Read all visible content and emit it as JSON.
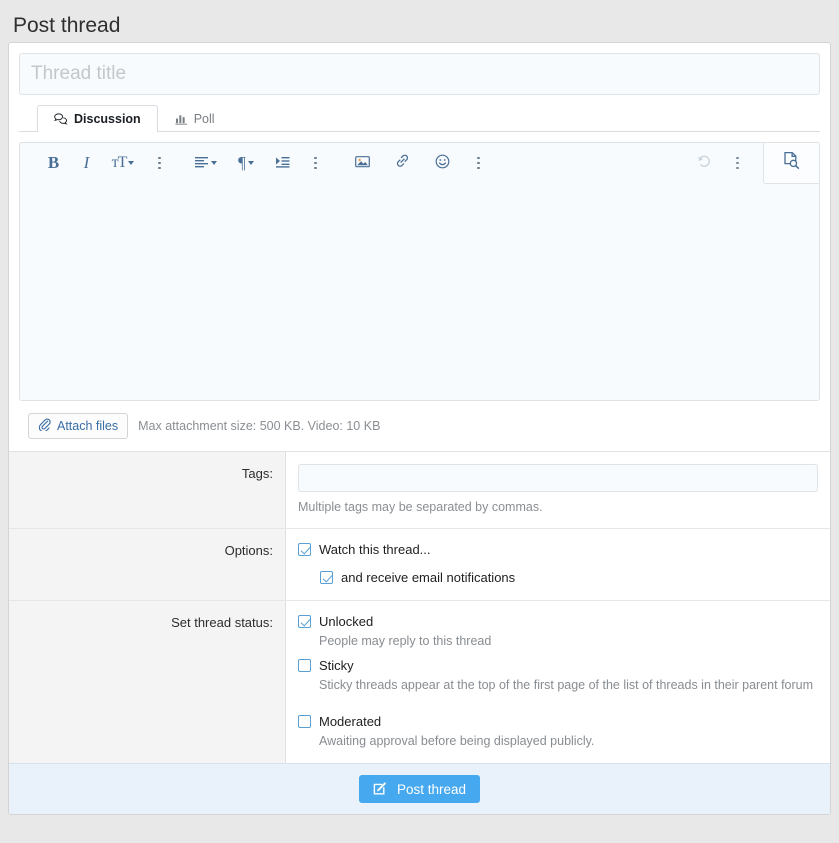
{
  "page": {
    "title": "Post thread"
  },
  "title_field": {
    "placeholder": "Thread title",
    "value": ""
  },
  "tabs": [
    {
      "label": "Discussion",
      "icon": "comments-icon",
      "active": true
    },
    {
      "label": "Poll",
      "icon": "poll-chart-icon",
      "active": false
    }
  ],
  "toolbar": {
    "bold": "B",
    "italic": "I",
    "font_size": "TT",
    "more_text": "vertical-dots-icon",
    "align": "align-left-icon",
    "paragraph": "pilcrow-icon",
    "indent": "indent-icon",
    "more_block": "vertical-dots-icon",
    "image": "image-icon",
    "link": "link-icon",
    "smilie": "smiley-icon",
    "more_insert": "vertical-dots-icon",
    "undo": "undo-icon",
    "more_right": "vertical-dots-icon",
    "preview": "document-preview-icon"
  },
  "editor": {
    "content": ""
  },
  "attachments": {
    "button_label": "Attach files",
    "icon": "paperclip-icon",
    "note": "Max attachment size: 500 KB. Video: 10 KB"
  },
  "tags": {
    "label": "Tags:",
    "value": "",
    "placeholder": "",
    "hint": "Multiple tags may be separated by commas."
  },
  "options": {
    "label": "Options:",
    "items": [
      {
        "label": "Watch this thread...",
        "checked": true,
        "indent": false
      },
      {
        "label": "and receive email notifications",
        "checked": true,
        "indent": true
      }
    ]
  },
  "thread_status": {
    "label": "Set thread status:",
    "items": [
      {
        "label": "Unlocked",
        "checked": true,
        "description": "People may reply to this thread"
      },
      {
        "label": "Sticky",
        "checked": false,
        "description": "Sticky threads appear at the top of the first page of the list of threads in their parent forum"
      },
      {
        "label": "Moderated",
        "checked": false,
        "description": "Awaiting approval before being displayed publicly."
      }
    ]
  },
  "footer": {
    "submit_label": "Post thread",
    "submit_icon": "pencil-square-icon"
  },
  "colors": {
    "accent": "#46a8ee",
    "page_bg": "#e8e8e8",
    "field_bg": "#f8fbfd",
    "label_col_bg": "#f4f4f4",
    "footer_bg": "#e9f2fb",
    "checkbox_blue": "#5a9fd4",
    "toolbar_icon": "#4a6f96"
  }
}
